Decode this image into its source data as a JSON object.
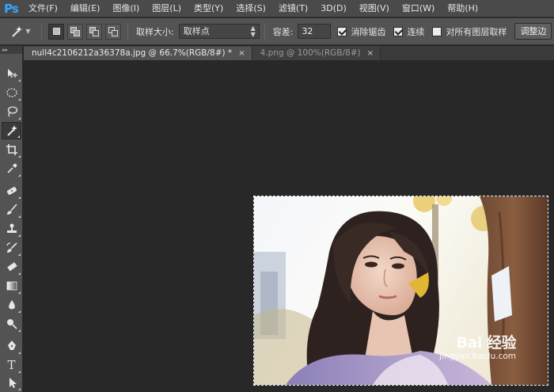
{
  "app": {
    "logo": "Ps"
  },
  "menu": [
    {
      "label": "文件(F)"
    },
    {
      "label": "编辑(E)"
    },
    {
      "label": "图像(I)"
    },
    {
      "label": "图层(L)"
    },
    {
      "label": "类型(Y)"
    },
    {
      "label": "选择(S)"
    },
    {
      "label": "滤镜(T)"
    },
    {
      "label": "3D(D)"
    },
    {
      "label": "视图(V)"
    },
    {
      "label": "窗口(W)"
    },
    {
      "label": "帮助(H)"
    }
  ],
  "options": {
    "tool_icon": "magic-wand-icon",
    "sample_size_label": "取样大小:",
    "sample_size_value": "取样点",
    "tolerance_label": "容差:",
    "tolerance_value": "32",
    "antialias_label": "消除锯齿",
    "antialias_checked": true,
    "contiguous_label": "连续",
    "contiguous_checked": true,
    "all_layers_label": "对所有图层取样",
    "all_layers_checked": false,
    "refine_edge_label": "调整边"
  },
  "tabs": [
    {
      "label": "null4c2106212a36378a.jpg @ 66.7%(RGB/8#) *",
      "active": true,
      "close": "×"
    },
    {
      "label": "4.png @ 100%(RGB/8#)",
      "active": false,
      "close": "×"
    }
  ],
  "tools": [
    {
      "name": "move-tool",
      "icon": "move-icon"
    },
    {
      "name": "marquee-tool",
      "icon": "ellipse-marquee-icon"
    },
    {
      "name": "lasso-tool",
      "icon": "lasso-icon"
    },
    {
      "name": "magic-wand-tool",
      "icon": "magic-wand-icon",
      "active": true
    },
    {
      "name": "crop-tool",
      "icon": "crop-icon"
    },
    {
      "name": "eyedropper-tool",
      "icon": "eyedropper-icon"
    },
    {
      "name": "healing-tool",
      "icon": "healing-brush-icon"
    },
    {
      "name": "brush-tool",
      "icon": "brush-icon"
    },
    {
      "name": "stamp-tool",
      "icon": "clone-stamp-icon"
    },
    {
      "name": "history-brush-tool",
      "icon": "history-brush-icon"
    },
    {
      "name": "eraser-tool",
      "icon": "eraser-icon"
    },
    {
      "name": "gradient-tool",
      "icon": "gradient-icon"
    },
    {
      "name": "blur-tool",
      "icon": "blur-drop-icon"
    },
    {
      "name": "dodge-tool",
      "icon": "dodge-icon"
    },
    {
      "name": "pen-tool",
      "icon": "pen-icon"
    },
    {
      "name": "type-tool",
      "icon": "type-icon",
      "glyph": "T"
    },
    {
      "name": "path-select-tool",
      "icon": "path-select-icon"
    }
  ],
  "watermark": {
    "logo": "Bai 经验",
    "sub": "jingyan.baidu.com"
  },
  "colors": {
    "menubar": "#4a4a4a",
    "optionsbar": "#535353",
    "workspace": "#282828",
    "ps_blue": "#31a8ff"
  }
}
